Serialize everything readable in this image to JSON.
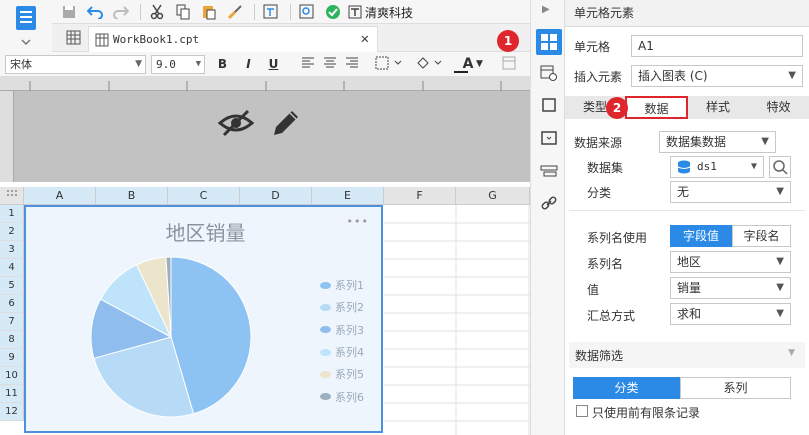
{
  "toolbar": {
    "font_tool_label": "清爽科技"
  },
  "file_tab": {
    "name": "WorkBook1.cpt"
  },
  "format": {
    "font_family": "宋体",
    "font_size": "9.0",
    "bold": "B",
    "italic": "I",
    "underline": "U",
    "font_color": "A"
  },
  "grid": {
    "columns": [
      "A",
      "B",
      "C",
      "D",
      "E",
      "F",
      "G"
    ],
    "rows": [
      "1",
      "2",
      "3",
      "4",
      "5",
      "6",
      "7",
      "8",
      "9",
      "10",
      "11",
      "12"
    ]
  },
  "chart": {
    "title": "地区销量",
    "more": "•••"
  },
  "chart_data": {
    "type": "pie",
    "title": "地区销量",
    "series": [
      {
        "name": "系列1",
        "value": 45,
        "color": "#8cc3f2"
      },
      {
        "name": "系列2",
        "value": 25,
        "color": "#b7dbf7"
      },
      {
        "name": "系列3",
        "value": 12,
        "color": "#8fbdee"
      },
      {
        "name": "系列4",
        "value": 10,
        "color": "#bfe3fa"
      },
      {
        "name": "系列5",
        "value": 6,
        "color": "#ece5cc"
      },
      {
        "name": "系列6",
        "value": 1,
        "color": "#9caebf"
      }
    ],
    "legend_position": "right"
  },
  "panel": {
    "title": "单元格元素",
    "cell_label": "单元格",
    "cell_value": "A1",
    "insert_label": "插入元素",
    "insert_value": "插入图表 (C)",
    "tabs": [
      "类型",
      "数据",
      "样式",
      "特效"
    ],
    "source_label": "数据来源",
    "source_value": "数据集数据",
    "dataset_label": "数据集",
    "dataset_value": "ds1",
    "category_label": "分类",
    "category_value": "无",
    "series_name_use_label": "系列名使用",
    "toggle_field_value": "字段值",
    "toggle_field_name": "字段名",
    "series_name_label": "系列名",
    "series_name_value": "地区",
    "value_label": "值",
    "value_value": "销量",
    "agg_label": "汇总方式",
    "agg_value": "求和",
    "filter_title": "数据筛选",
    "filter_tab_category": "分类",
    "filter_tab_series": "系列",
    "limit_checkbox_label": "只使用前有限条记录"
  },
  "badges": {
    "one": "1",
    "two": "2"
  },
  "colors": {
    "accent": "#2b8ae6",
    "badge": "#e0262d",
    "chart_border": "#4d90dc"
  }
}
